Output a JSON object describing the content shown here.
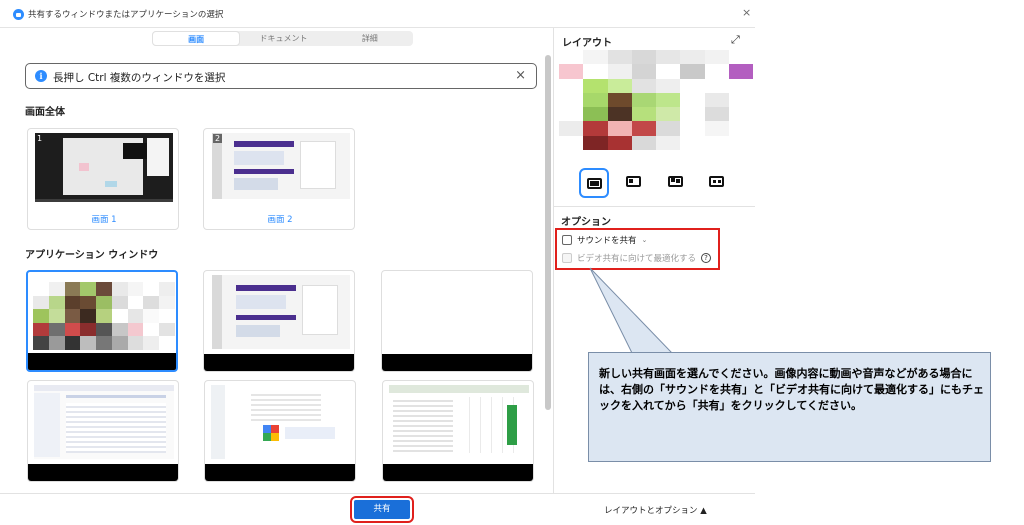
{
  "window": {
    "title": "共有するウィンドウまたはアプリケーションの選択",
    "close_label": "×"
  },
  "tabs": [
    {
      "label": "画面",
      "active": true
    },
    {
      "label": "ドキュメント",
      "active": false
    },
    {
      "label": "詳細",
      "active": false
    }
  ],
  "tip": {
    "icon_glyph": "i",
    "text": "長押し Ctrl 複数のウィンドウを選択",
    "close_label": "×"
  },
  "sections": {
    "screens_title": "画面全体",
    "apps_title": "アプリケーション ウィンドウ"
  },
  "screens": [
    {
      "label": "画面 1",
      "number": "1"
    },
    {
      "label": "画面 2",
      "number": "2"
    }
  ],
  "right_panel": {
    "layout_title": "レイアウト",
    "expand_icon": "expand-icon",
    "options_title": "オプション",
    "share_sound_label": "サウンドを共有",
    "optimize_video_label": "ビデオ共有に向けて最適化する",
    "help_glyph": "?",
    "chevron_glyph": "⌄",
    "expand_glyph": "⤢"
  },
  "callout": {
    "text": "新しい共有画面を選んでください。画像内容に動画や音声などがある場合には、右側の「サウンドを共有」と「ビデオ共有に向けて最適化する」にもチェックを入れてから「共有」をクリックしてください。"
  },
  "footer": {
    "share_label": "共有",
    "layout_options_label": "レイアウトとオプション ▲"
  },
  "colors": {
    "accent": "#2d8cff",
    "highlight": "#e0201c",
    "callout_bg": "#dce6f2"
  }
}
